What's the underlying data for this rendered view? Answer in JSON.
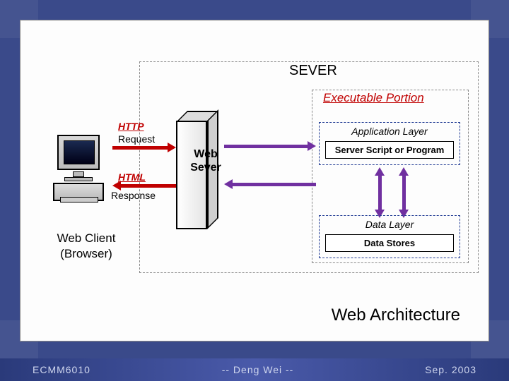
{
  "diagram": {
    "sever_label": "SEVER",
    "executable_portion_label": "Executable Portion",
    "client": {
      "line1": "Web Client",
      "line2": "(Browser)"
    },
    "server_box": {
      "line1": "Web",
      "line2": "Sever"
    },
    "arrows": {
      "http_label": "HTTP",
      "request_label": "Request",
      "html_label": "HTML",
      "response_label": "Response"
    },
    "app_layer": {
      "title": "Application Layer",
      "box": "Server Script or Program"
    },
    "data_layer": {
      "title": "Data Layer",
      "box": "Data Stores"
    },
    "title": "Web Architecture"
  },
  "footer": {
    "course": "ECMM6010",
    "author": "-- Deng Wei --",
    "date": "Sep. 2003"
  }
}
